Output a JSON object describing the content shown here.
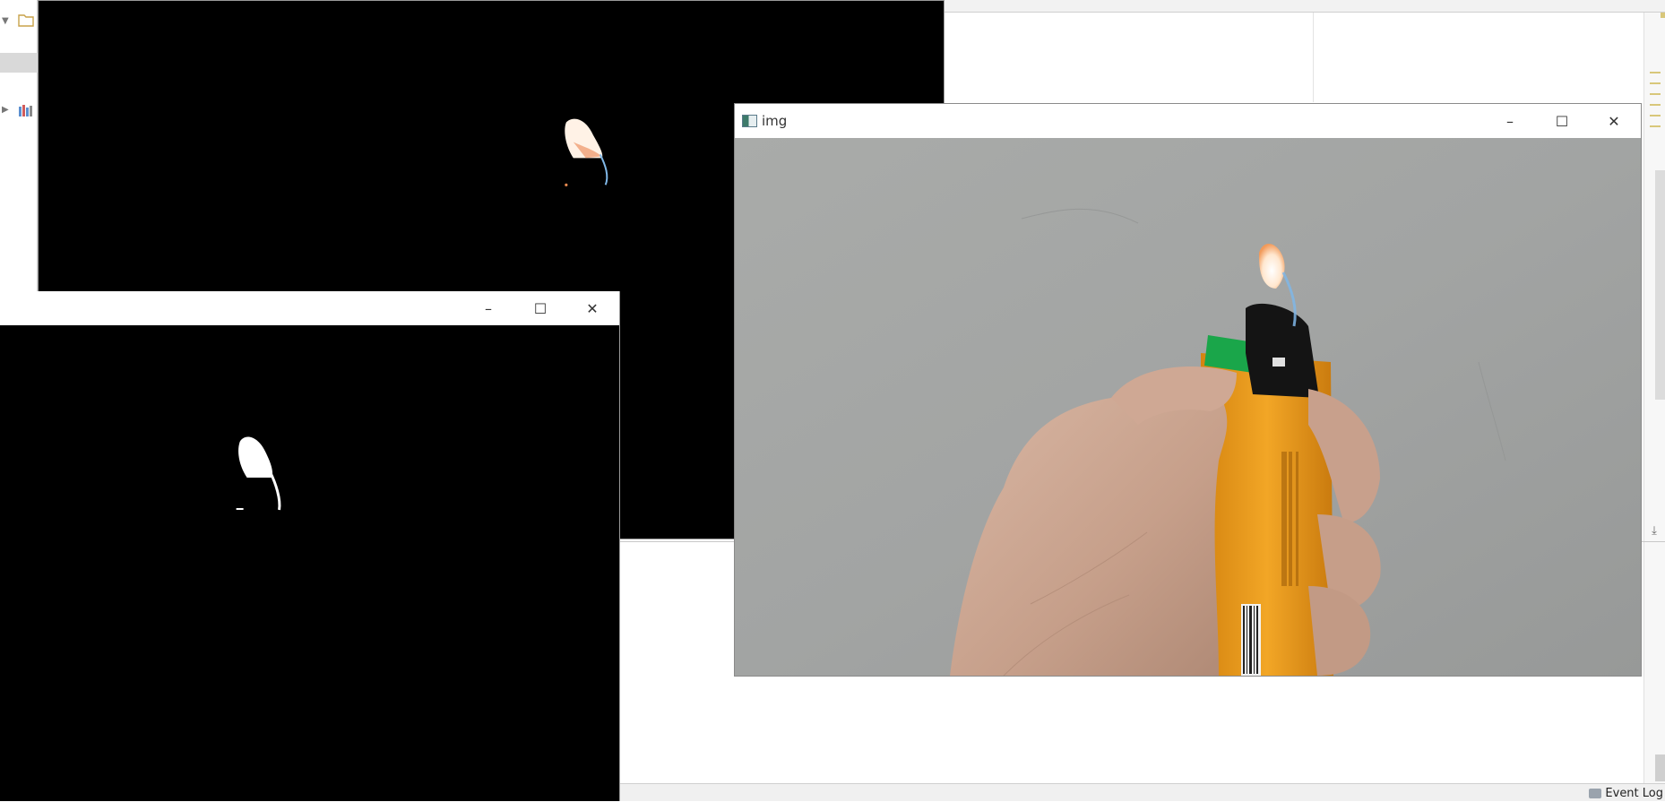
{
  "ide": {
    "status_bar": {
      "event_log_label": "Event Log",
      "event_log_icon": "speech-bubble-icon"
    },
    "left_panel_icons": [
      "folder-icon",
      "library-icon"
    ]
  },
  "windows": {
    "result": {
      "title": "",
      "content": "color-masked flame on black"
    },
    "mask": {
      "title": "",
      "minimize_glyph": "–",
      "maximize_glyph": "☐",
      "close_glyph": "✕"
    },
    "img": {
      "title": "img",
      "minimize_glyph": "–",
      "maximize_glyph": "☐",
      "close_glyph": "✕"
    }
  },
  "colors": {
    "flame_core": "#fff3e6",
    "flame_edge": "#f2b48a",
    "flame_blue": "#7fb6e8",
    "lighter_body": "#f0a020",
    "lighter_green": "#1aa64a",
    "wall": "#a3a5a4"
  }
}
